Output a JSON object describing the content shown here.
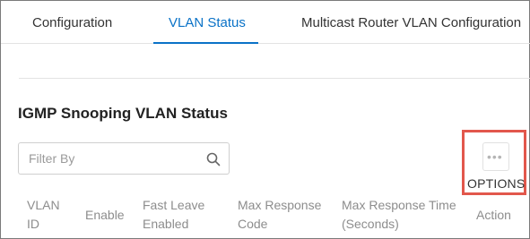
{
  "tabs": [
    {
      "label": "Configuration",
      "active": false
    },
    {
      "label": "VLAN Status",
      "active": true
    },
    {
      "label": "Multicast Router VLAN Configuration",
      "active": false
    }
  ],
  "section": {
    "title": "IGMP Snooping VLAN Status"
  },
  "filter": {
    "placeholder": "Filter By",
    "value": ""
  },
  "options": {
    "label": "OPTIONS",
    "icon": "more-horizontal-icon"
  },
  "table": {
    "columns": [
      {
        "line1": "VLAN",
        "line2": "ID"
      },
      {
        "line1": "",
        "line2": "Enable"
      },
      {
        "line1": "Fast Leave",
        "line2": "Enabled"
      },
      {
        "line1": "Max Response",
        "line2": "Code"
      },
      {
        "line1": "Max Response Time",
        "line2": "(Seconds)"
      },
      {
        "line1": "",
        "line2": "Action"
      }
    ]
  },
  "colors": {
    "accent": "#0a72c7",
    "highlight": "#e2574c",
    "header_text": "#8d8d8d"
  }
}
